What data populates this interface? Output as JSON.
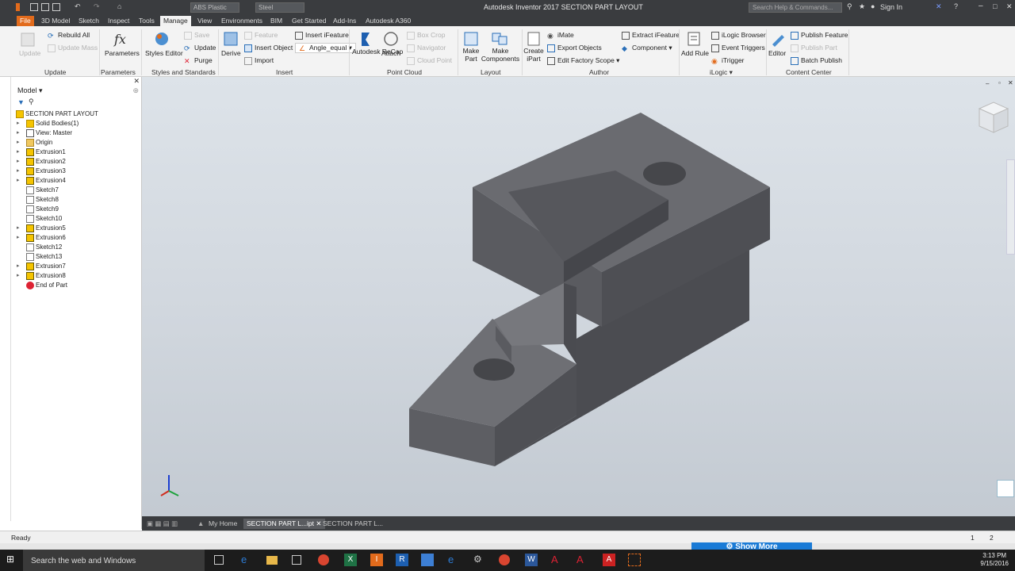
{
  "titlebar": {
    "title": "Autodesk Inventor 2017   SECTION PART LAYOUT",
    "material": "ABS Plastic",
    "appearance": "Steel",
    "search_placeholder": "Search Help & Commands...",
    "signin": "Sign In"
  },
  "tabs": [
    "File",
    "3D Model",
    "Sketch",
    "Inspect",
    "Tools",
    "Manage",
    "View",
    "Environments",
    "BIM",
    "Get Started",
    "Add-Ins",
    "Autodesk A360"
  ],
  "active_tab": "Manage",
  "ribbon": {
    "update": {
      "update": "Update",
      "rebuild_all": "Rebuild All",
      "update_mass": "Update Mass",
      "group": "Update"
    },
    "parameters": {
      "parameters": "Parameters",
      "group": "Parameters"
    },
    "styles": {
      "styles_editor": "Styles Editor",
      "save": "Save",
      "update": "Update",
      "purge": "Purge",
      "group": "Styles and Standards"
    },
    "insert": {
      "derive": "Derive",
      "feature": "Feature",
      "insert_object": "Insert Object",
      "import": "Import",
      "insert_ifeature": "Insert iFeature",
      "angle_equal": "Angle_equal",
      "group": "Insert"
    },
    "point_cloud": {
      "recap": "Autodesk ReCap",
      "attach": "Attach",
      "box_crop": "Box Crop",
      "navigator": "Navigator",
      "cloud_point": "Cloud Point",
      "group": "Point Cloud"
    },
    "layout": {
      "make_part": "Make Part",
      "make_components": "Make Components",
      "group": "Layout"
    },
    "author": {
      "create_ipart": "Create iPart",
      "imate": "iMate",
      "export_objects": "Export Objects",
      "edit_factory_scope": "Edit Factory Scope",
      "extract_ifeature": "Extract iFeature",
      "component": "Component",
      "group": "Author"
    },
    "ilogic": {
      "add_rule": "Add Rule",
      "ilogic_browser": "iLogic Browser",
      "event_triggers": "Event Triggers",
      "itrigger": "iTrigger",
      "group": "iLogic"
    },
    "content_center": {
      "editor": "Editor",
      "publish_feature": "Publish Feature",
      "publish_part": "Publish Part",
      "batch_publish": "Batch Publish",
      "group": "Content Center"
    }
  },
  "browser": {
    "header": "Model",
    "root": "SECTION PART LAYOUT",
    "items": [
      {
        "label": "Solid Bodies(1)",
        "icon": "solid-bodies-icon"
      },
      {
        "label": "View: Master",
        "icon": "view-icon"
      },
      {
        "label": "Origin",
        "icon": "folder-icon"
      },
      {
        "label": "Extrusion1",
        "icon": "extrusion-icon"
      },
      {
        "label": "Extrusion2",
        "icon": "extrusion-icon"
      },
      {
        "label": "Extrusion3",
        "icon": "extrusion-icon"
      },
      {
        "label": "Extrusion4",
        "icon": "extrusion-icon"
      },
      {
        "label": "Sketch7",
        "icon": "sketch-icon"
      },
      {
        "label": "Sketch8",
        "icon": "sketch-icon"
      },
      {
        "label": "Sketch9",
        "icon": "sketch-icon"
      },
      {
        "label": "Sketch10",
        "icon": "sketch-icon"
      },
      {
        "label": "Extrusion5",
        "icon": "extrusion-icon"
      },
      {
        "label": "Extrusion6",
        "icon": "extrusion-icon"
      },
      {
        "label": "Sketch12",
        "icon": "sketch-icon"
      },
      {
        "label": "Sketch13",
        "icon": "sketch-icon"
      },
      {
        "label": "Extrusion7",
        "icon": "extrusion-icon"
      },
      {
        "label": "Extrusion8",
        "icon": "extrusion-icon"
      },
      {
        "label": "End of Part",
        "icon": "end-of-part-icon"
      }
    ]
  },
  "doctabs": [
    "My Home",
    "SECTION PART L...ipt",
    "SECTION PART L..."
  ],
  "status": {
    "text": "Ready",
    "n1": "1",
    "n2": "2"
  },
  "show_more": "Show More",
  "taskbar": {
    "search": "Search the web and Windows",
    "time": "3:13 PM",
    "date": "9/15/2016"
  },
  "colors": {
    "accent": "#e26b1c",
    "titlebar": "#3a3c3f",
    "part_top": "#6f7075",
    "part_side": "#55565b"
  }
}
